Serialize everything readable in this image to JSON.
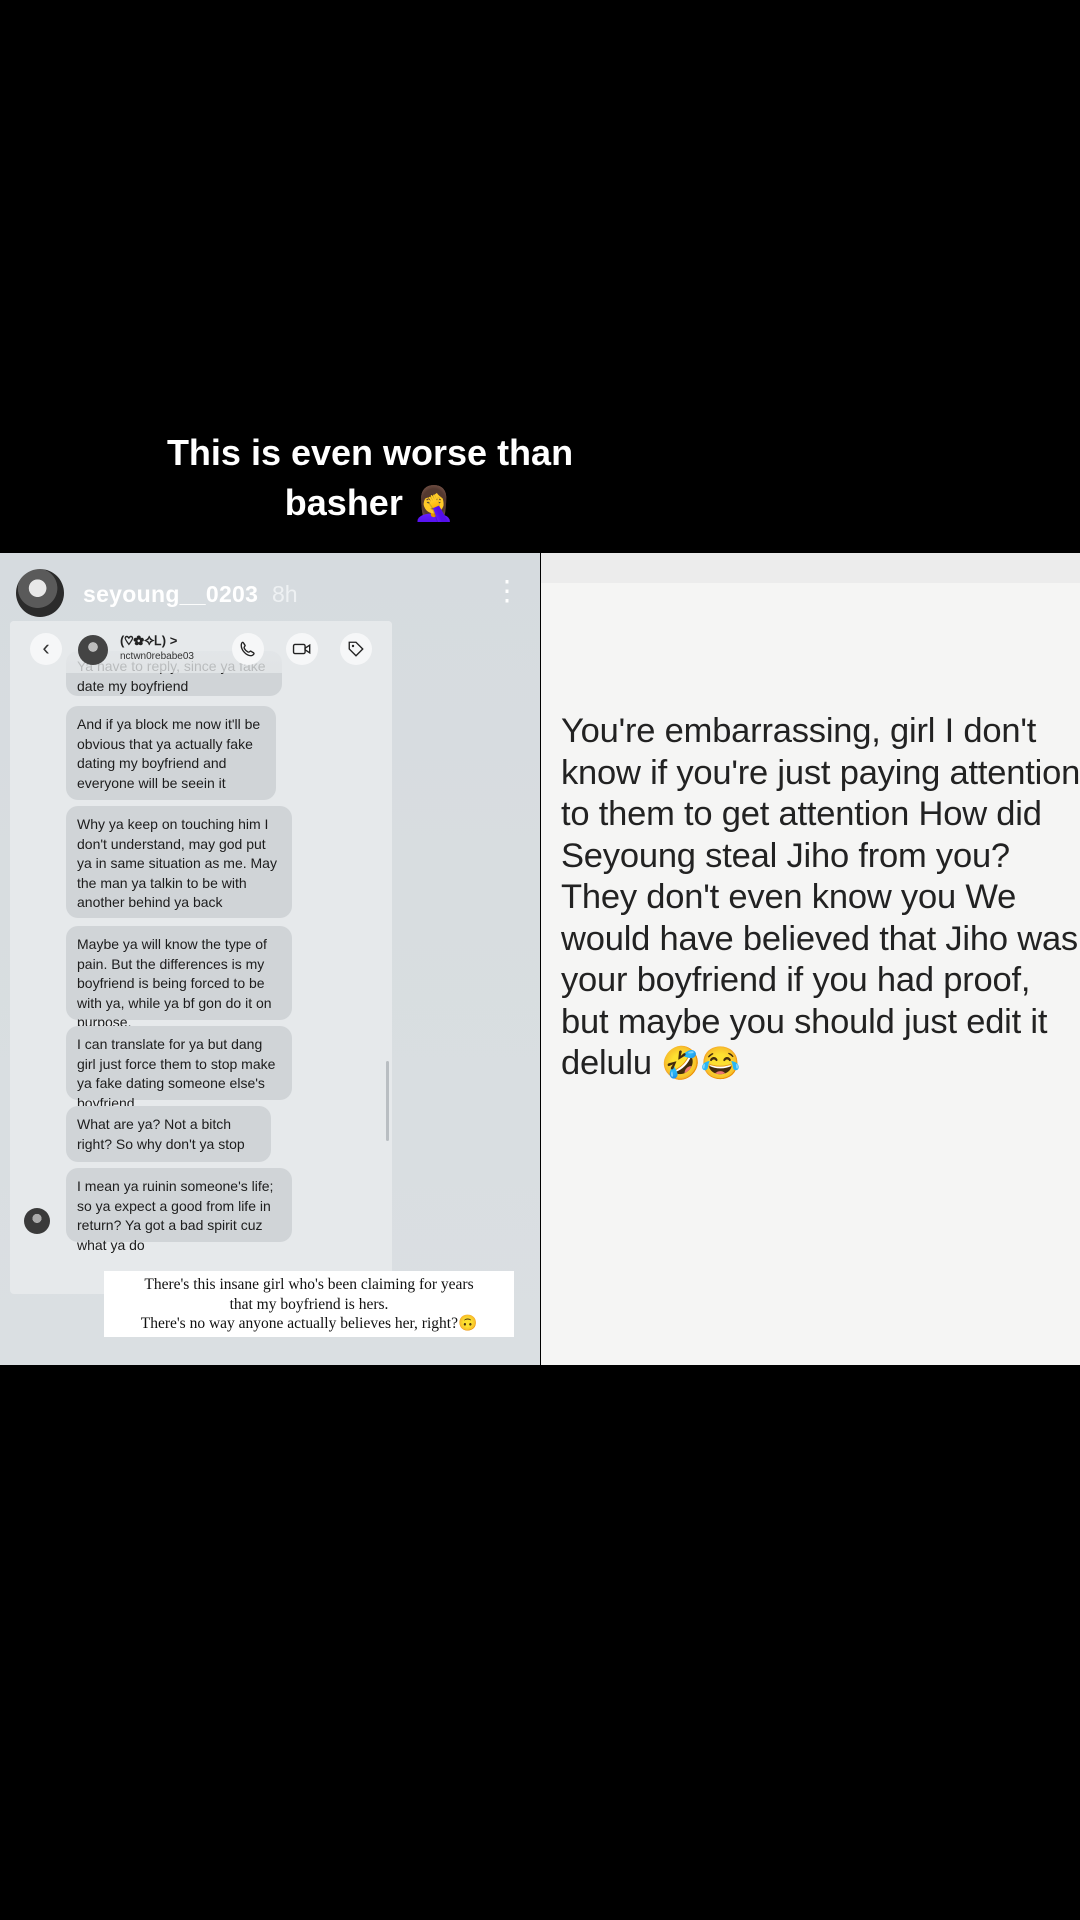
{
  "caption": {
    "line1": "This is even worse than",
    "line2": "basher",
    "emoji": "🤦‍♀️"
  },
  "story": {
    "username": "seyoung__0203",
    "time": "8h",
    "menu_icon": "⋮"
  },
  "dm": {
    "contact_name": "(♡✿✧Ꮮ) >",
    "contact_handle": "nctwn0rebabe03",
    "icons": [
      "back-icon",
      "phone-icon",
      "video-icon",
      "tag-icon"
    ],
    "messages": [
      "Ya have to reply, since ya fake date my boyfriend",
      "And if ya block me now it'll be obvious that ya actually fake dating my boyfriend and everyone will be seein it",
      "Why ya keep on touching him I don't understand, may god put ya in same situation as me. May the man ya talkin to be with another behind ya back",
      "Maybe ya will know the type of pain. But the differences is my boyfriend is being forced to be with ya, while ya bf gon do it on purpose.",
      "I can translate for ya but dang girl just force them to stop make ya fake dating someone else's boyfriend",
      "What are ya? Not a bitch right? So why don't ya stop",
      "I mean ya ruinin someone's life; so ya expect a good from life in return? Ya got a bad spirit cuz what ya do"
    ]
  },
  "quote": {
    "line1": "There's this insane girl who's been claiming for years",
    "line2": "that my boyfriend is hers.",
    "line3": "There's no way anyone actually believes her, right?🙃"
  },
  "comment": {
    "text": "You're embarrassing, girl I don't know if you're just paying attention to them to get attention How did Seyoung steal Jiho from you? They don't even know you We would have believed that Jiho was your boyfriend if you had proof, but maybe you should just edit it delulu",
    "emojis": "🤣😂"
  }
}
